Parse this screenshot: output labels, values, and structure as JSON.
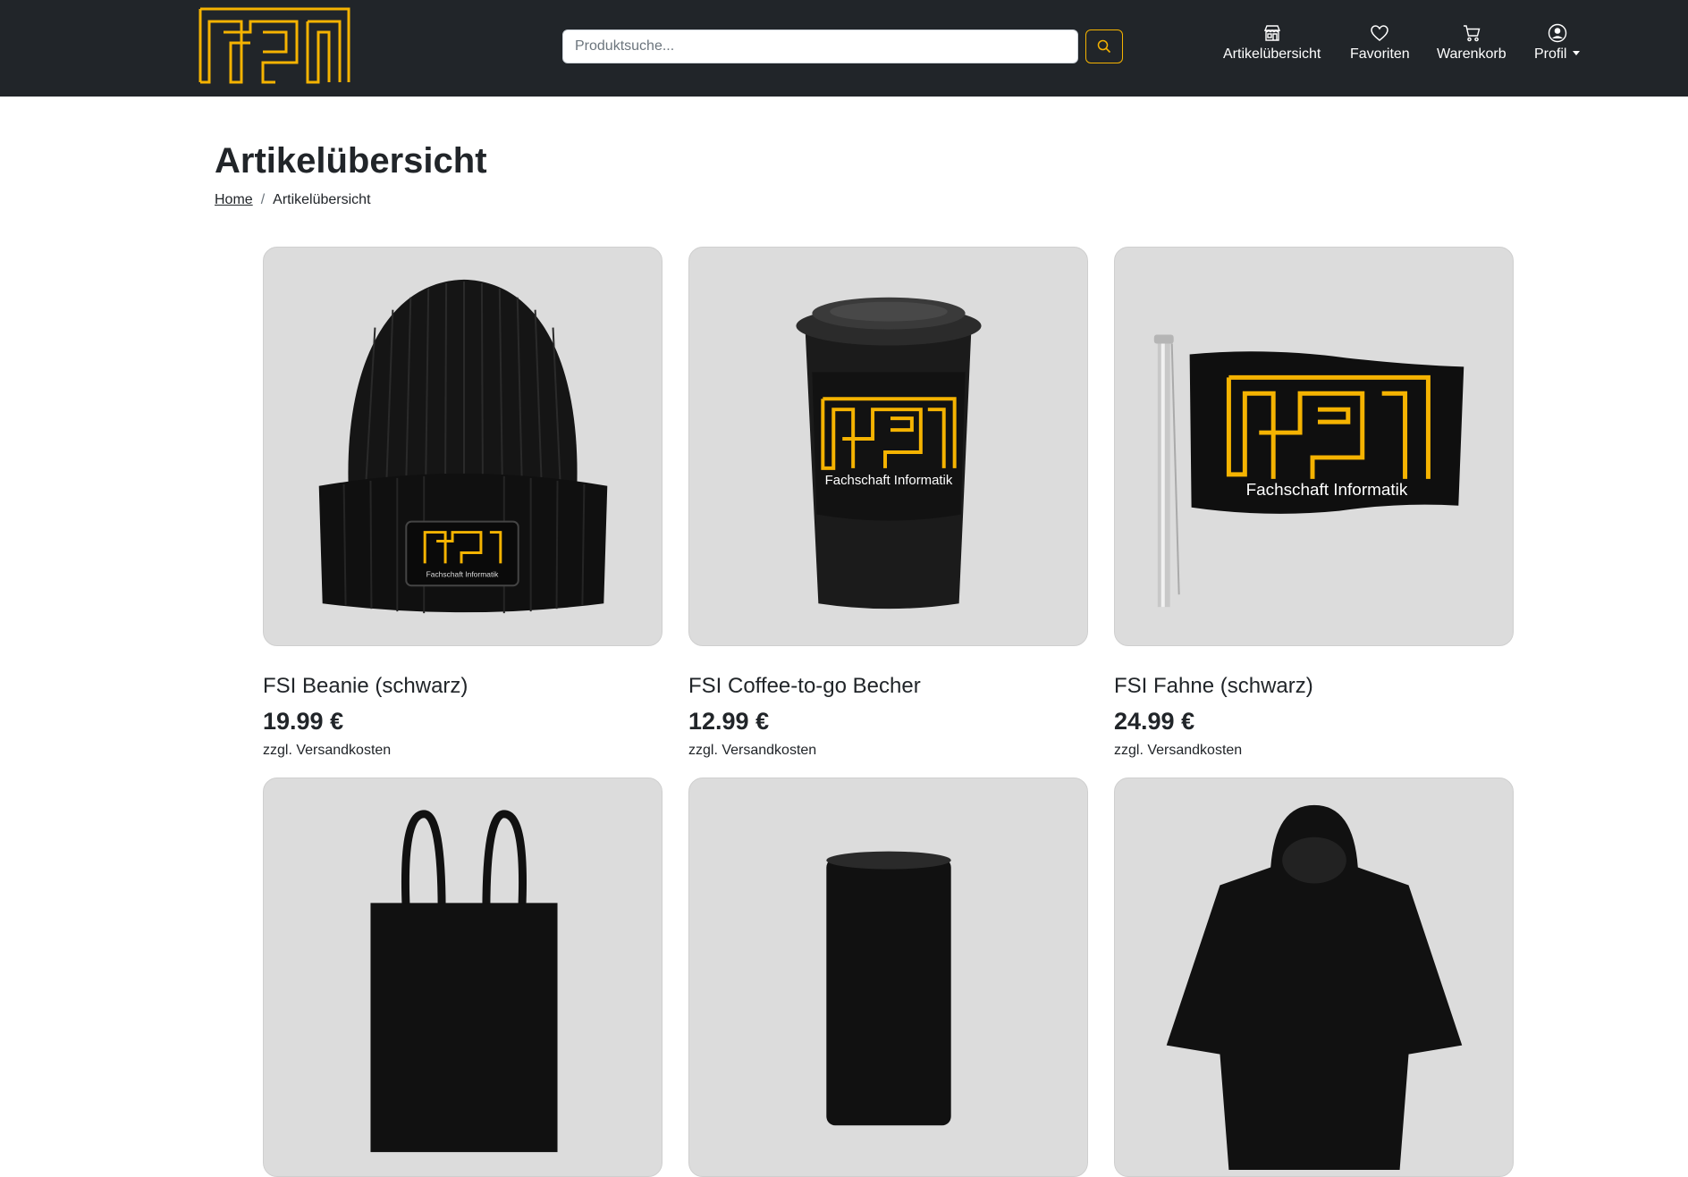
{
  "header": {
    "logo_alt": "FSI",
    "search": {
      "placeholder": "Produktsuche...",
      "value": ""
    },
    "nav": [
      {
        "label": "Artikelübersicht",
        "icon": "shop-icon"
      },
      {
        "label": "Favoriten",
        "icon": "heart-icon"
      },
      {
        "label": "Warenkorb",
        "icon": "cart-icon"
      },
      {
        "label": "Profil",
        "icon": "user-circle-icon"
      }
    ]
  },
  "colors": {
    "navbar": "#212529",
    "accent": "#f5b301",
    "card_bg": "#dcdcdc"
  },
  "page": {
    "title": "Artikelübersicht",
    "breadcrumb": [
      {
        "label": "Home"
      },
      {
        "label": "Artikelübersicht"
      }
    ]
  },
  "products": [
    {
      "name": "FSI Beanie (schwarz)",
      "price": "19.99 €",
      "shipping": "zzgl. Versandkosten",
      "image": "beanie"
    },
    {
      "name": "FSI Coffee-to-go Becher",
      "price": "12.99 €",
      "shipping": "zzgl. Versandkosten",
      "image": "coffee-cup"
    },
    {
      "name": "FSI Fahne (schwarz)",
      "price": "24.99 €",
      "shipping": "zzgl. Versandkosten",
      "image": "flag"
    },
    {
      "image": "tote-bag"
    },
    {
      "image": "mug"
    },
    {
      "image": "hoodie"
    }
  ],
  "branding": {
    "tagline": "Fachschaft Informatik"
  }
}
